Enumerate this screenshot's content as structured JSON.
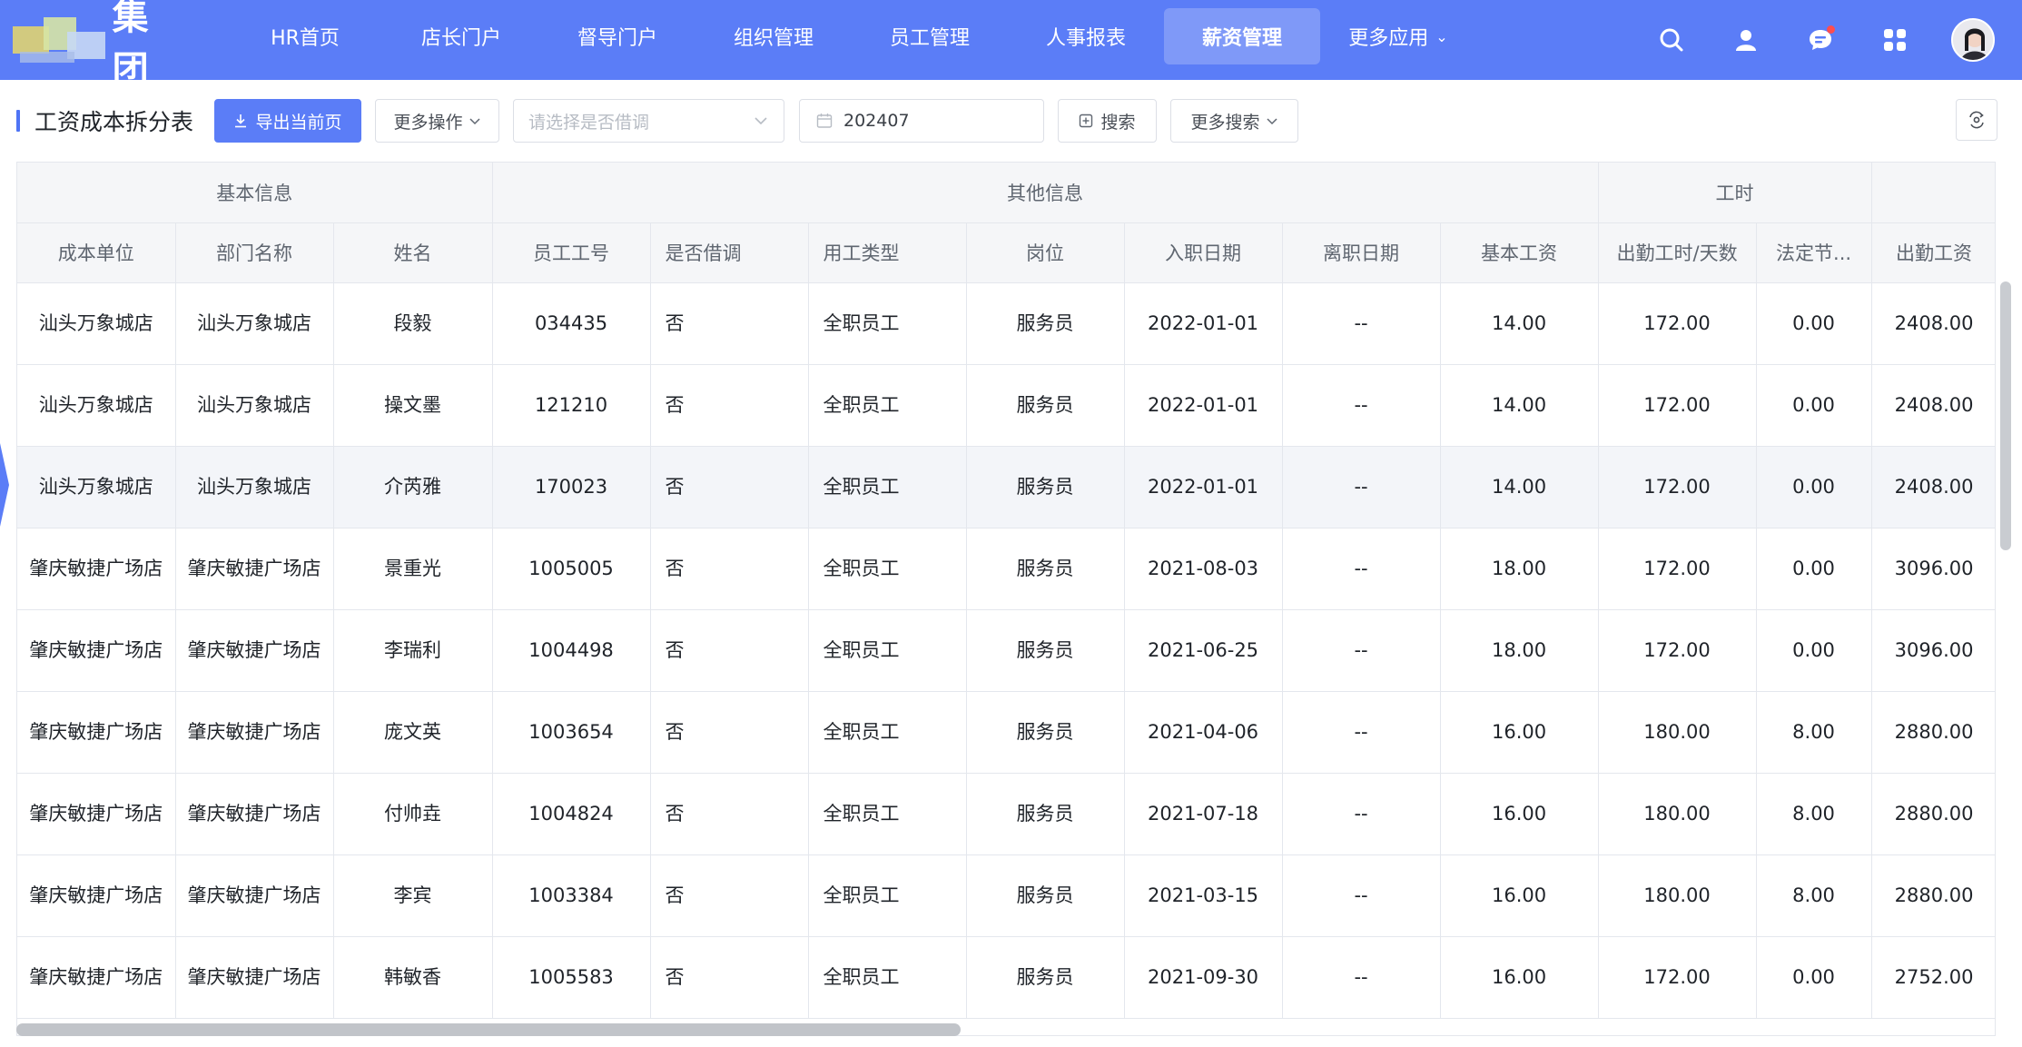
{
  "app": {
    "logo_text": "集团",
    "nav": [
      {
        "label": "HR首页",
        "active": false
      },
      {
        "label": "店长门户",
        "active": false
      },
      {
        "label": "督导门户",
        "active": false
      },
      {
        "label": "组织管理",
        "active": false
      },
      {
        "label": "员工管理",
        "active": false
      },
      {
        "label": "人事报表",
        "active": false
      },
      {
        "label": "薪资管理",
        "active": true
      },
      {
        "label": "更多应用",
        "active": false
      }
    ],
    "nav_more_chevron": "⌄",
    "colors": {
      "brand": "#5b7df7",
      "notification_dot": "#ff4d4f"
    }
  },
  "toolbar": {
    "page_title": "工资成本拆分表",
    "export_label": "导出当前页",
    "more_actions_label": "更多操作",
    "borrow_select_placeholder": "请选择是否借调",
    "month_value": "202407",
    "search_label": "搜索",
    "more_search_label": "更多搜索"
  },
  "table": {
    "groups": [
      "基本信息",
      "其他信息",
      "工时"
    ],
    "columns": [
      "成本单位",
      "部门名称",
      "姓名",
      "员工工号",
      "是否借调",
      "用工类型",
      "岗位",
      "入职日期",
      "离职日期",
      "基本工资",
      "出勤工时/天数",
      "法定节...",
      "出勤工资"
    ],
    "rows": [
      [
        "汕头万象城店",
        "汕头万象城店",
        "段毅",
        "034435",
        "否",
        "全职员工",
        "服务员",
        "2022-01-01",
        "--",
        "14.00",
        "172.00",
        "0.00",
        "2408.00"
      ],
      [
        "汕头万象城店",
        "汕头万象城店",
        "操文墨",
        "121210",
        "否",
        "全职员工",
        "服务员",
        "2022-01-01",
        "--",
        "14.00",
        "172.00",
        "0.00",
        "2408.00"
      ],
      [
        "汕头万象城店",
        "汕头万象城店",
        "介芮雅",
        "170023",
        "否",
        "全职员工",
        "服务员",
        "2022-01-01",
        "--",
        "14.00",
        "172.00",
        "0.00",
        "2408.00"
      ],
      [
        "肇庆敏捷广场店",
        "肇庆敏捷广场店",
        "景重光",
        "1005005",
        "否",
        "全职员工",
        "服务员",
        "2021-08-03",
        "--",
        "18.00",
        "172.00",
        "0.00",
        "3096.00"
      ],
      [
        "肇庆敏捷广场店",
        "肇庆敏捷广场店",
        "李瑞利",
        "1004498",
        "否",
        "全职员工",
        "服务员",
        "2021-06-25",
        "--",
        "18.00",
        "172.00",
        "0.00",
        "3096.00"
      ],
      [
        "肇庆敏捷广场店",
        "肇庆敏捷广场店",
        "庞文英",
        "1003654",
        "否",
        "全职员工",
        "服务员",
        "2021-04-06",
        "--",
        "16.00",
        "180.00",
        "8.00",
        "2880.00"
      ],
      [
        "肇庆敏捷广场店",
        "肇庆敏捷广场店",
        "付帅垚",
        "1004824",
        "否",
        "全职员工",
        "服务员",
        "2021-07-18",
        "--",
        "16.00",
        "180.00",
        "8.00",
        "2880.00"
      ],
      [
        "肇庆敏捷广场店",
        "肇庆敏捷广场店",
        "李宾",
        "1003384",
        "否",
        "全职员工",
        "服务员",
        "2021-03-15",
        "--",
        "16.00",
        "180.00",
        "8.00",
        "2880.00"
      ],
      [
        "肇庆敏捷广场店",
        "肇庆敏捷广场店",
        "韩敏香",
        "1005583",
        "否",
        "全职员工",
        "服务员",
        "2021-09-30",
        "--",
        "16.00",
        "172.00",
        "0.00",
        "2752.00"
      ]
    ],
    "hover_row_index": 2
  }
}
